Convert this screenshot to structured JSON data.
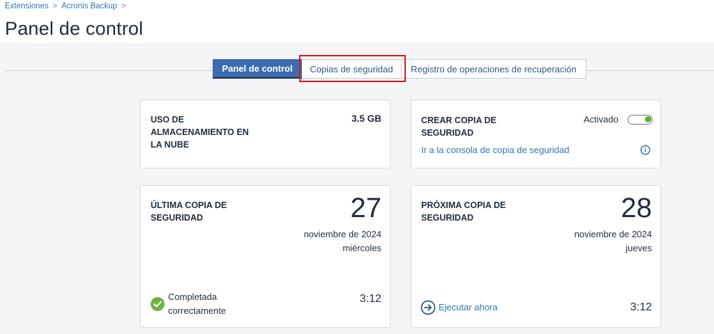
{
  "breadcrumb": {
    "items": [
      "Extensiones",
      "Acronis Backup"
    ],
    "separator": ">"
  },
  "page": {
    "title": "Panel de control"
  },
  "tabs": [
    {
      "label": "Panel de control",
      "active": true
    },
    {
      "label": "Copias de seguridad",
      "active": false
    },
    {
      "label": "Registro de operaciones de recuperación",
      "active": false
    }
  ],
  "storage_card": {
    "title": "USO DE ALMACENAMIENTO EN LA NUBE",
    "title_lines": [
      "USO DE",
      "ALMACENAMIENTO EN",
      "LA NUBE"
    ],
    "value": "3.5 GB"
  },
  "backup_card": {
    "title_lines": [
      "CREAR COPIA DE",
      "SEGURIDAD"
    ],
    "toggle_label": "Activado",
    "toggle_on": true,
    "console_link": "Ir a la consola de copia de seguridad",
    "info_icon": "info-icon"
  },
  "last_backup": {
    "title_lines": [
      "ÚLTIMA COPIA DE",
      "SEGURIDAD"
    ],
    "day": "27",
    "month_year": "noviembre de 2024",
    "weekday": "miércoles",
    "status_lines": [
      "Completada",
      "correctamente"
    ],
    "status_icon": "check-circle-icon",
    "time": "3:12"
  },
  "next_backup": {
    "title_lines": [
      "PRÓXIMA COPIA DE",
      "SEGURIDAD"
    ],
    "day": "28",
    "month_year": "noviembre de 2024",
    "weekday": "jueves",
    "run_now": "Ejecutar ahora",
    "run_icon": "arrow-circle-right-icon",
    "time": "3:12"
  },
  "colors": {
    "accent": "#3b6db0",
    "link": "#2a7ab7",
    "success": "#6db33f",
    "toggle_on": "#5bb12f",
    "highlight": "#d9151c"
  }
}
